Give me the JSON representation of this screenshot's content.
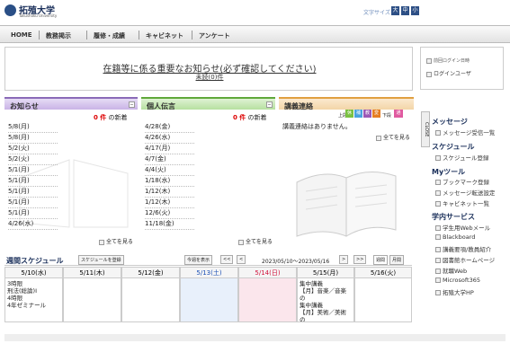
{
  "header": {
    "university": "拓殖大学",
    "university_en": "Takushoku University",
    "font_size_label": "文字サイズ",
    "font_sizes": [
      "大",
      "中",
      "小"
    ]
  },
  "menu": [
    "HOME",
    "教務掲示",
    "履修・成績",
    "キャビネット",
    "アンケート"
  ],
  "notice": {
    "title": "在籍等に係る重要なお知らせ(必ず確認してください)",
    "count": "未読(0)件"
  },
  "login": {
    "last_login_label": "前回ログイン日時",
    "user_label": "ログインユーザ"
  },
  "oshirase": {
    "title": "お知らせ",
    "new_num": "0",
    "new_unit": " 件",
    "new_suffix": " の新着",
    "dates": [
      "5/8(月)",
      "5/8(月)",
      "5/2(火)",
      "5/2(火)",
      "5/1(月)",
      "5/1(月)",
      "5/1(月)",
      "5/1(月)",
      "5/1(月)",
      "4/26(水)"
    ],
    "see_all": "全てを見る"
  },
  "dengon": {
    "title": "個人伝言",
    "new_num": "0",
    "new_unit": " 件",
    "new_suffix": " の新着",
    "dates": [
      "4/28(金)",
      "4/26(水)",
      "4/17(月)",
      "4/7(金)",
      "4/4(火)",
      "1/18(水)",
      "1/12(木)",
      "1/12(木)",
      "12/6(火)",
      "11/18(金)"
    ],
    "see_all": "全てを見る"
  },
  "kogi": {
    "title": "講義連絡",
    "nav_prev": "上段",
    "nav_next": "下段",
    "tabs": [
      "休",
      "補",
      "教",
      "変"
    ],
    "extra_tab": "通",
    "message": "講義連絡はありません。",
    "see_all": "全てを見る"
  },
  "close_tab": "CLOSE",
  "right": {
    "message_hdr": "メッセージ",
    "message_items": [
      "メッセージ受信一覧"
    ],
    "schedule_hdr": "スケジュール",
    "schedule_items": [
      "スケジュール登録"
    ],
    "mytool_hdr": "Myツール",
    "mytool_items": [
      "ブックマーク登録",
      "メッセージ転送設定",
      "キャビネット一覧"
    ],
    "service_hdr": "学内サービス",
    "service_items": [
      "学生用Webメール",
      "Blackboard",
      "講義要項/教員紹介",
      "図書館ホームページ",
      "就職Web",
      "Microsoft365",
      "拓殖大学HP"
    ]
  },
  "schedule": {
    "title": "週間スケジュール",
    "register": "スケジュールを登録",
    "today": "今週を表示",
    "range": "2023/05/10〜2023/05/16",
    "nav_prev2": "<<",
    "nav_prev1": "<",
    "nav_next1": ">",
    "nav_next2": ">>",
    "week_btn": "週間",
    "month_btn": "月間",
    "days": [
      "5/10(水)",
      "5/11(木)",
      "5/12(金)",
      "5/13(土)",
      "5/14(日)",
      "5/15(月)",
      "5/16(火)"
    ],
    "cell_wed": "3時限\n刑法(総論)Ⅰ\n4時限\n4年ゼミナール",
    "cell_mon": "集中講義\n【月】音楽／音楽の\n集中講義\n【月】美術／美術の"
  },
  "colors": {
    "oshirase": "#c9b3e6",
    "dengon": "#b6e0a0",
    "kogi": "#f3d5a7",
    "saturday": "#e8f0fb",
    "sunday": "#fbe6ec"
  }
}
